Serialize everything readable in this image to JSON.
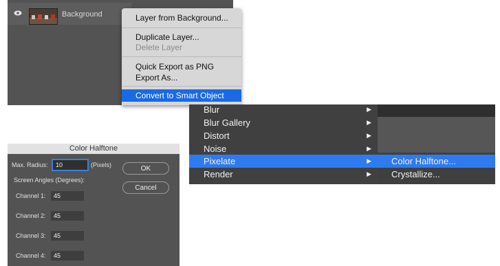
{
  "layers_panel": {
    "layer_name": "Background",
    "context_menu": {
      "items": [
        {
          "label": "Layer from Background...",
          "disabled": false,
          "selected": false
        },
        {
          "label": "Duplicate Layer...",
          "disabled": false,
          "selected": false
        },
        {
          "label": "Delete Layer",
          "disabled": true,
          "selected": false
        },
        {
          "label": "Quick Export as PNG",
          "disabled": false,
          "selected": false
        },
        {
          "label": "Export As...",
          "disabled": false,
          "selected": false
        },
        {
          "label": "Convert to Smart Object",
          "disabled": false,
          "selected": true
        }
      ]
    }
  },
  "halftone_dialog": {
    "title": "Color Halftone",
    "max_radius_label": "Max. Radius:",
    "max_radius_value": "10",
    "max_radius_unit": "(Pixels)",
    "screen_angles_label": "Screen Angles (Degrees):",
    "channels": [
      {
        "label": "Channel 1:",
        "value": "45"
      },
      {
        "label": "Channel 2:",
        "value": "45"
      },
      {
        "label": "Channel 3:",
        "value": "45"
      },
      {
        "label": "Channel 4:",
        "value": "45"
      }
    ],
    "ok_label": "OK",
    "cancel_label": "Cancel"
  },
  "filter_menu": {
    "items": [
      {
        "label": "Blur",
        "highlighted": false
      },
      {
        "label": "Blur Gallery",
        "highlighted": false
      },
      {
        "label": "Distort",
        "highlighted": false
      },
      {
        "label": "Noise",
        "highlighted": false
      },
      {
        "label": "Pixelate",
        "highlighted": true
      },
      {
        "label": "Render",
        "highlighted": false
      }
    ],
    "submenu_items": [
      {
        "label": "Color Halftone...",
        "highlighted": true
      },
      {
        "label": "Crystallize...",
        "highlighted": false
      }
    ],
    "arrow_glyph": "▶"
  },
  "colors": {
    "selection_blue": "#1a6ae6",
    "menu_highlight": "#2e7bf0",
    "panel_gray": "#535353"
  }
}
